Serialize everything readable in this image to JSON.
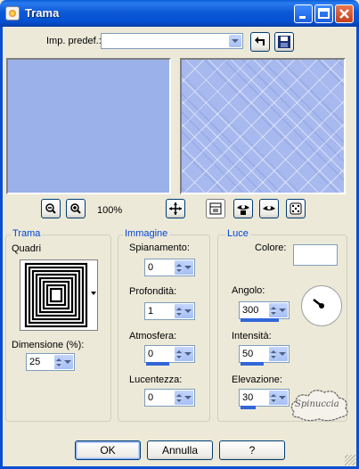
{
  "window": {
    "title": "Trama"
  },
  "preset": {
    "label": "Imp. predef.:",
    "value": ""
  },
  "zoom": {
    "value": "100%"
  },
  "trama": {
    "title": "Trama",
    "pattern_label": "Quadri",
    "size_label": "Dimensione (%):",
    "size_value": "25"
  },
  "immagine": {
    "title": "Immagine",
    "fields": [
      {
        "label": "Spianamento:",
        "value": "0",
        "level": 0
      },
      {
        "label": "Profondità:",
        "value": "1",
        "level": 0.05
      },
      {
        "label": "Atmosfera:",
        "value": "0",
        "level": 0
      },
      {
        "label": "Lucentezza:",
        "value": "0",
        "level": 0
      }
    ]
  },
  "luce": {
    "title": "Luce",
    "color_label": "Colore:",
    "color_value": "#ffffff",
    "fields": [
      {
        "label": "Angolo:",
        "value": "300",
        "level": 0.83
      },
      {
        "label": "Intensità:",
        "value": "50",
        "level": 0.5
      },
      {
        "label": "Elevazione:",
        "value": "30",
        "level": 0.33
      }
    ]
  },
  "buttons": {
    "ok": "OK",
    "cancel": "Annulla",
    "help": "?"
  },
  "watermark": {
    "text": "Spinuccia"
  },
  "colors": {
    "preview_left": "#9bb1ea",
    "preview_right": "#a7b9ee",
    "accent": "#0046d5"
  }
}
